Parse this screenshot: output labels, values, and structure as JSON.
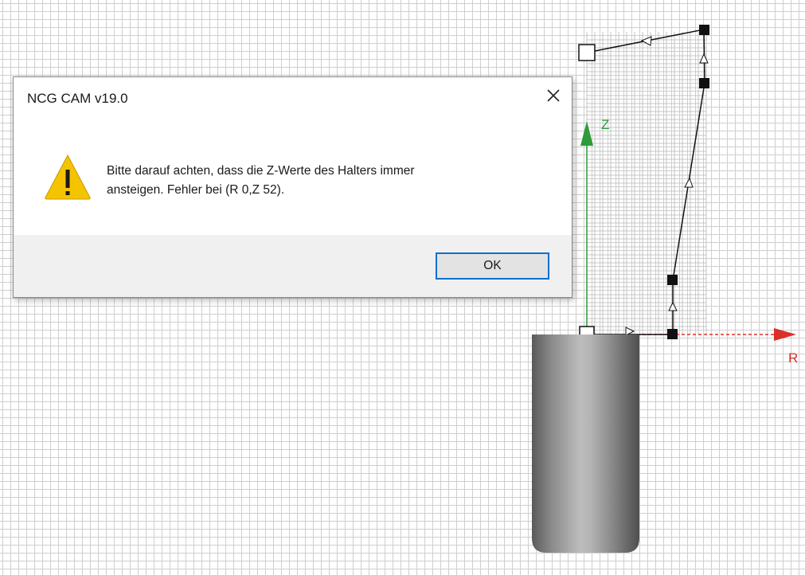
{
  "canvas": {
    "axes": {
      "z_label": "Z",
      "r_label": "R",
      "z_color": "#2e9a3a",
      "r_color": "#d9302a"
    },
    "icons": [
      "outline-point-icon",
      "filled-point-icon",
      "direction-arrow-icon",
      "axis-arrow-icon"
    ]
  },
  "dialog": {
    "title": "NCG CAM v19.0",
    "close_icon": "close-icon",
    "warning_icon": "warning-icon",
    "message_line1": "Bitte darauf achten, dass die Z-Werte des Halters immer",
    "message_line2": "ansteigen. Fehler bei (R 0,Z 52).",
    "ok_label": "OK",
    "colors": {
      "warning_fill": "#f5c400",
      "button_border": "#0a6fd0"
    }
  }
}
